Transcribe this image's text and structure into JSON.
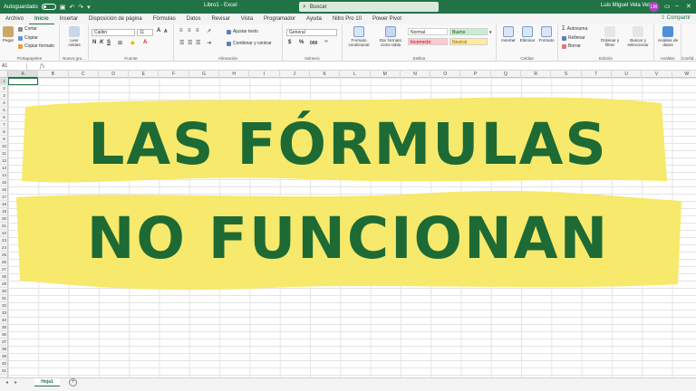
{
  "titlebar": {
    "autosave_label": "Autoguardado",
    "title": "Libro1 - Excel",
    "search_placeholder": "Buscar",
    "user_name": "Luis Miguel Vela Vela",
    "user_initials": "LM",
    "color": "#217346"
  },
  "tabs": {
    "items": [
      "Archivo",
      "Inicio",
      "Insertar",
      "Disposición de página",
      "Fórmulas",
      "Datos",
      "Revisar",
      "Vista",
      "Programador",
      "Ayuda",
      "Nitro Pro 10",
      "Power Pivot"
    ],
    "active": "Inicio",
    "share_label": "Compartir"
  },
  "ribbon": {
    "clipboard": {
      "paste": "Pegar",
      "cut": "Cortar",
      "copy": "Copiar",
      "format_painter": "Copiar formato",
      "label": "Portapapeles"
    },
    "newgroup": {
      "read_cells": "Leer celdas",
      "label": "Nuevo gru..."
    },
    "font": {
      "name": "Calibri",
      "size": "11",
      "bold": "N",
      "italic": "K",
      "underline": "S",
      "label": "Fuente"
    },
    "alignment": {
      "wrap": "Ajustar texto",
      "merge": "Combinar y centrar",
      "label": "Alineación"
    },
    "number": {
      "format": "General",
      "currency": "$",
      "percent": "%",
      "thousands": "000",
      "label": "Número"
    },
    "styles": {
      "conditional": "Formato condicional",
      "as_table": "Dar formato como tabla",
      "cells": [
        "Normal",
        "Bueno",
        "Incorrecto",
        "Neutral"
      ],
      "label": "Estilos"
    },
    "cells": {
      "insert": "Insertar",
      "delete": "Eliminar",
      "format": "Formato",
      "label": "Celdas"
    },
    "editing": {
      "autosum": "Autosuma",
      "fill": "Rellenar",
      "clear": "Borrar",
      "sort": "Ordenar y filtrar",
      "find": "Buscar y seleccionar",
      "label": "Edición"
    },
    "analysis": {
      "analyze": "Análisis de datos",
      "label": "Análisis"
    },
    "confidential": {
      "label": "Confid..."
    }
  },
  "formula_bar": {
    "name_box": "A1",
    "fx": "fx"
  },
  "sheet": {
    "columns": [
      "A",
      "B",
      "C",
      "D",
      "E",
      "F",
      "G",
      "H",
      "I",
      "J",
      "K",
      "L",
      "M",
      "N",
      "O",
      "P",
      "Q",
      "R",
      "S",
      "T",
      "U",
      "V",
      "W"
    ],
    "rows": [
      "1",
      "2",
      "3",
      "4",
      "5",
      "6",
      "7",
      "8",
      "9",
      "10",
      "11",
      "12",
      "13",
      "14",
      "15",
      "16",
      "17",
      "18",
      "19",
      "20",
      "21",
      "22",
      "23",
      "24",
      "25",
      "26",
      "27",
      "28",
      "29",
      "30",
      "31",
      "32",
      "33",
      "34",
      "35",
      "36",
      "37",
      "38",
      "39",
      "40",
      "41"
    ],
    "active_cell": "A1"
  },
  "banner": {
    "line1": "LAS FÓRMULAS",
    "line2": "NO FUNCIONAN",
    "highlight_color": "#f6e96b",
    "text_color": "#1e6a35"
  },
  "sheettabs": {
    "sheet_name": "Hoja1",
    "add": "+"
  }
}
